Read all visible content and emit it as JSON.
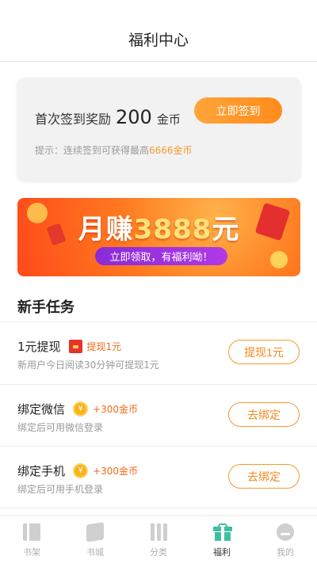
{
  "header": {
    "title": "福利中心"
  },
  "signin": {
    "prefix": "首次签到奖励",
    "amount": "200",
    "unit": "金币",
    "button_label": "立即签到",
    "tip_prefix": "提示：连续签到可获得最高",
    "tip_highlight": "6666金币"
  },
  "banner": {
    "headline_pre": "月赚",
    "headline_amount": "3888",
    "headline_post": "元",
    "pill_text": "立即领取，有福利呦！"
  },
  "section": {
    "title": "新手任务"
  },
  "tasks": [
    {
      "name": "1元提现",
      "reward": "提现1元",
      "reward_icon": "red-packet-icon",
      "desc": "新用户今日阅读30分钟可提现1元",
      "action": "提现1元"
    },
    {
      "name": "绑定微信",
      "reward": "+300金币",
      "reward_icon": "coin-icon",
      "desc": "绑定后可用微信登录",
      "action": "去绑定"
    },
    {
      "name": "绑定手机",
      "reward": "+300金币",
      "reward_icon": "coin-icon",
      "desc": "绑定后可用手机登录",
      "action": "去绑定"
    }
  ],
  "coin_symbol": "¥",
  "tabbar": {
    "items": [
      {
        "label": "书架",
        "icon": "bookshelf-icon"
      },
      {
        "label": "书城",
        "icon": "bookstore-icon"
      },
      {
        "label": "分类",
        "icon": "category-icon"
      },
      {
        "label": "福利",
        "icon": "gift-icon",
        "active": true
      },
      {
        "label": "我的",
        "icon": "profile-icon"
      }
    ]
  },
  "colors": {
    "accent": "#ff8c1a",
    "tab_active": "#3fbfa2"
  }
}
